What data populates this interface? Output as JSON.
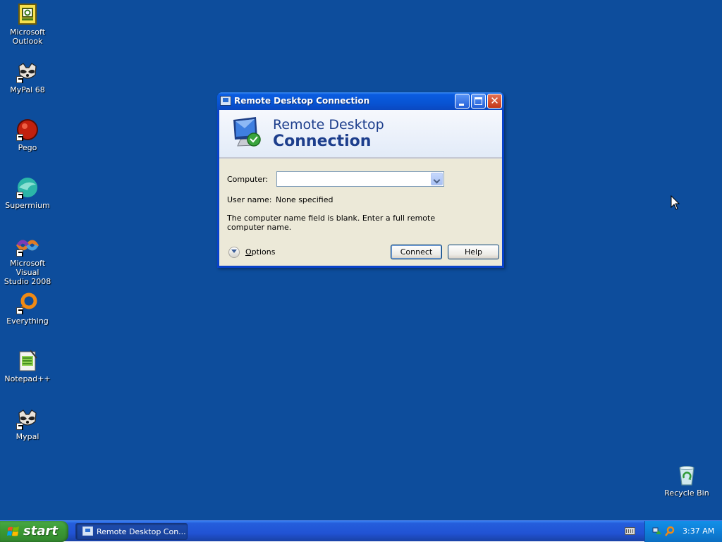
{
  "desktop": {
    "background": "#0d4d9c",
    "icons": [
      {
        "label_lines": [
          "Microsoft",
          "Outlook"
        ],
        "icon": "outlook-icon"
      },
      {
        "label_lines": [
          "MyPal 68"
        ],
        "icon": "raccoon-icon"
      },
      {
        "label_lines": [
          "Pego"
        ],
        "icon": "pego-icon"
      },
      {
        "label_lines": [
          "Supermium"
        ],
        "icon": "supermium-icon"
      },
      {
        "label_lines": [
          "Microsoft Visual",
          "Studio 2008"
        ],
        "icon": "visual-studio-icon"
      },
      {
        "label_lines": [
          "Everything"
        ],
        "icon": "everything-icon"
      },
      {
        "label_lines": [
          "Notepad++"
        ],
        "icon": "notepadpp-icon"
      },
      {
        "label_lines": [
          "Mypal"
        ],
        "icon": "raccoon-icon"
      },
      {
        "label_lines": [
          "Recycle Bin"
        ],
        "icon": "recycle-bin-icon"
      }
    ]
  },
  "window": {
    "title": "Remote Desktop Connection",
    "banner_line1": "Remote Desktop",
    "banner_line2": "Connection",
    "computer_label": "Computer:",
    "computer_value": "",
    "username_label": "User name:",
    "username_value": "None specified",
    "info_text": "The computer name field is blank. Enter a full remote computer name.",
    "options_label": "Options",
    "connect_label": "Connect",
    "help_label": "Help",
    "titlebar_color": "#0854d4",
    "body_color": "#ece9d8"
  },
  "taskbar": {
    "start_label": "start",
    "task_label": "Remote Desktop Con...",
    "clock": "3:37 AM",
    "color": "#245edc",
    "start_color": "#3c9b35",
    "tray_color": "#0f83dc"
  }
}
